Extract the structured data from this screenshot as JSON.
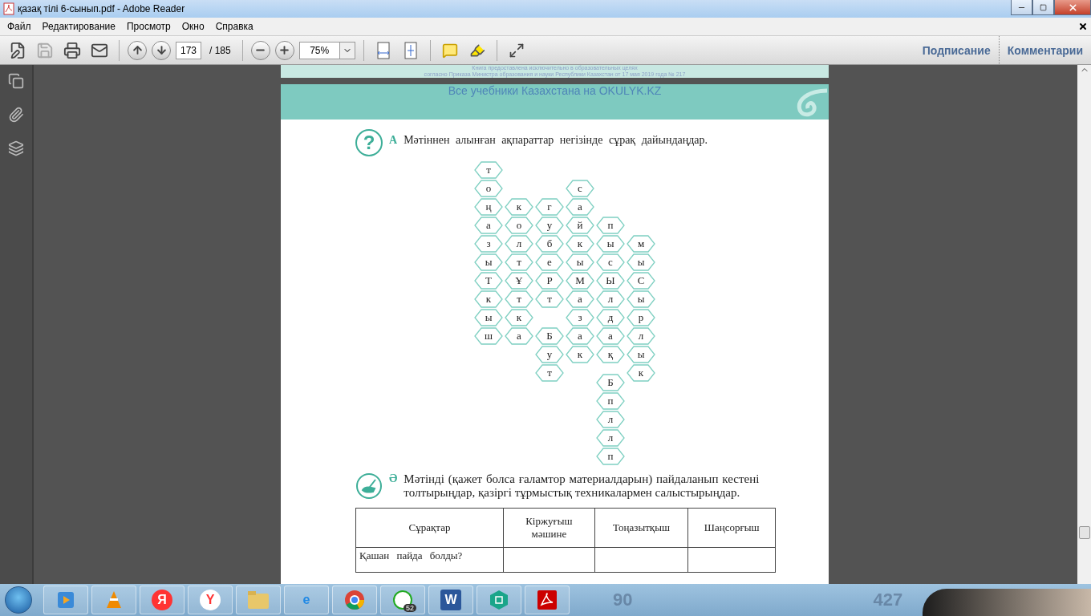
{
  "window": {
    "title": "қазақ тілі 6-сынып.pdf - Adobe Reader"
  },
  "menu": [
    "Файл",
    "Редактирование",
    "Просмотр",
    "Окно",
    "Справка"
  ],
  "toolbar": {
    "page_value": "173",
    "page_total": "/ 185",
    "zoom_value": "75%",
    "right_tabs": [
      "Подписание",
      "Комментарии"
    ]
  },
  "document": {
    "prev_page_notes": [
      "Книга предоставлена исключительно в образовательных целях",
      "согласно Приказа Министра образования и науки Республики Казахстан от 17 мая 2019 года № 217"
    ],
    "banner": "Все учебники Казахстана на OKULYK.KZ",
    "task_a": {
      "icon": "?",
      "letter": "А",
      "text": "Мәтіннен алынған ақпараттар негізінде сұрақ дайындаңдар."
    },
    "hex_columns": [
      [
        {
          "kind": "letter",
          "text": "т"
        },
        {
          "kind": "letter",
          "text": "о"
        },
        {
          "kind": "letter",
          "text": "ң"
        },
        {
          "kind": "letter",
          "text": "а"
        },
        {
          "kind": "letter",
          "text": "з"
        },
        {
          "kind": "letter",
          "text": "ы"
        },
        {
          "kind": "letter",
          "text": "Т"
        },
        {
          "kind": "letter",
          "text": "к"
        },
        {
          "kind": "letter",
          "text": "ы"
        },
        {
          "kind": "letter",
          "text": "ш"
        }
      ],
      [
        {
          "kind": "gap"
        },
        {
          "kind": "gap"
        },
        {
          "kind": "letter",
          "text": "к"
        },
        {
          "kind": "letter",
          "text": "о"
        },
        {
          "kind": "letter",
          "text": "л"
        },
        {
          "kind": "letter",
          "text": "т"
        },
        {
          "kind": "letter",
          "text": "Ұ"
        },
        {
          "kind": "letter",
          "text": "т"
        },
        {
          "kind": "letter",
          "text": "к"
        },
        {
          "kind": "letter",
          "text": "а"
        }
      ],
      [
        {
          "kind": "gap"
        },
        {
          "kind": "gap"
        },
        {
          "kind": "letter",
          "text": "г"
        },
        {
          "kind": "letter",
          "text": "у"
        },
        {
          "kind": "letter",
          "text": "б"
        },
        {
          "kind": "letter",
          "text": "е"
        },
        {
          "kind": "letter",
          "text": "Р"
        },
        {
          "kind": "letter",
          "text": "т"
        },
        {
          "kind": "gap"
        },
        {
          "kind": "letter",
          "text": "Б"
        },
        {
          "kind": "letter",
          "text": "у"
        },
        {
          "kind": "letter",
          "text": "т"
        }
      ],
      [
        {
          "kind": "gap"
        },
        {
          "kind": "letter",
          "text": "с"
        },
        {
          "kind": "letter",
          "text": "а"
        },
        {
          "kind": "letter",
          "text": "й"
        },
        {
          "kind": "letter",
          "text": "к"
        },
        {
          "kind": "letter",
          "text": "ы"
        },
        {
          "kind": "letter",
          "text": "М"
        },
        {
          "kind": "letter",
          "text": "а"
        },
        {
          "kind": "letter",
          "text": "з"
        },
        {
          "kind": "letter",
          "text": "а"
        },
        {
          "kind": "letter",
          "text": "к"
        }
      ],
      [
        {
          "kind": "gap"
        },
        {
          "kind": "gap"
        },
        {
          "kind": "gap"
        },
        {
          "kind": "letter",
          "text": "п"
        },
        {
          "kind": "letter",
          "text": "ы"
        },
        {
          "kind": "letter",
          "text": "с"
        },
        {
          "kind": "letter",
          "text": "Ы"
        },
        {
          "kind": "letter",
          "text": "л"
        },
        {
          "kind": "letter",
          "text": "д"
        },
        {
          "kind": "letter",
          "text": "а"
        },
        {
          "kind": "letter",
          "text": "қ"
        },
        {
          "kind": "half_gap"
        },
        {
          "kind": "letter",
          "text": "Б"
        },
        {
          "kind": "letter",
          "text": "п"
        },
        {
          "kind": "letter",
          "text": "л"
        },
        {
          "kind": "letter",
          "text": "л"
        },
        {
          "kind": "letter",
          "text": "п"
        }
      ],
      [
        {
          "kind": "gap"
        },
        {
          "kind": "gap"
        },
        {
          "kind": "gap"
        },
        {
          "kind": "gap"
        },
        {
          "kind": "letter",
          "text": "м"
        },
        {
          "kind": "letter",
          "text": "ы"
        },
        {
          "kind": "letter",
          "text": "С"
        },
        {
          "kind": "letter",
          "text": "ы"
        },
        {
          "kind": "letter",
          "text": "р"
        },
        {
          "kind": "letter",
          "text": "л"
        },
        {
          "kind": "letter",
          "text": "ы"
        },
        {
          "kind": "letter",
          "text": "к"
        }
      ]
    ],
    "task_b": {
      "letter": "Ә",
      "text": "Мәтінді (қажет болса ғаламтор материалдарын) пайдаланып кестені толтырыңдар, қазіргі тұрмыстық техникалармен салыстырыңдар."
    },
    "table": {
      "columns": [
        "Сұрақтар",
        "Кіржуғыш мәшине",
        "Тоңазытқыш",
        "Шаңсорғыш"
      ],
      "rows": [
        [
          "Қашан пайда болды?",
          "",
          "",
          ""
        ]
      ]
    }
  },
  "taskbar": {
    "apps": [
      {
        "kind": "media"
      },
      {
        "kind": "vlc"
      },
      {
        "kind": "yandex",
        "glyph": "Я"
      },
      {
        "kind": "ybrowser",
        "glyph": "Y"
      },
      {
        "kind": "explorer"
      },
      {
        "kind": "ie",
        "glyph": "e"
      },
      {
        "kind": "chrome"
      },
      {
        "kind": "whatsapp",
        "badge": "52"
      },
      {
        "kind": "word",
        "glyph": "W"
      },
      {
        "kind": "teal"
      },
      {
        "kind": "acrobat"
      }
    ],
    "background_texts": [
      "90",
      "427"
    ]
  }
}
